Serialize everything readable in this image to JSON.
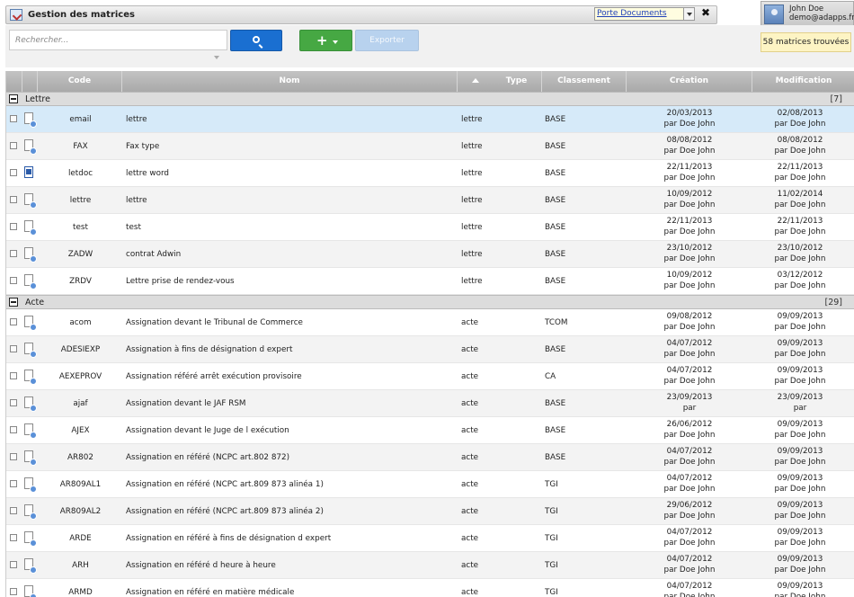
{
  "app": {
    "title": "Gestion des matrices"
  },
  "doc_selector": {
    "label": "Porte Documents"
  },
  "user": {
    "name": "John Doe",
    "email": "demo@adapps.fr"
  },
  "search": {
    "placeholder": "Rechercher..."
  },
  "toolbar": {
    "add_label": "+",
    "export_label": "Exporter"
  },
  "result_count": "58 matrices trouvées",
  "columns": {
    "code": "Code",
    "nom": "Nom",
    "type": "Type",
    "classement": "Classement",
    "creation": "Création",
    "modification": "Modification"
  },
  "groups": [
    {
      "label": "Lettre",
      "count": "[7]"
    },
    {
      "label": "Acte",
      "count": "[29]"
    }
  ],
  "rows_lettre": [
    {
      "code": "email",
      "nom": "lettre",
      "type": "lettre",
      "classement": "BASE",
      "cre_date": "20/03/2013",
      "cre_by": "par Doe John",
      "mod_date": "02/08/2013",
      "mod_by": "par Doe John"
    },
    {
      "code": "FAX",
      "nom": "Fax type",
      "type": "lettre",
      "classement": "BASE",
      "cre_date": "08/08/2012",
      "cre_by": "par Doe John",
      "mod_date": "08/08/2012",
      "mod_by": "par Doe John"
    },
    {
      "code": "letdoc",
      "nom": "lettre word",
      "type": "lettre",
      "classement": "BASE",
      "cre_date": "22/11/2013",
      "cre_by": "par Doe John",
      "mod_date": "22/11/2013",
      "mod_by": "par Doe John"
    },
    {
      "code": "lettre",
      "nom": "lettre",
      "type": "lettre",
      "classement": "BASE",
      "cre_date": "10/09/2012",
      "cre_by": "par Doe John",
      "mod_date": "11/02/2014",
      "mod_by": "par Doe John"
    },
    {
      "code": "test",
      "nom": "test",
      "type": "lettre",
      "classement": "BASE",
      "cre_date": "22/11/2013",
      "cre_by": "par Doe John",
      "mod_date": "22/11/2013",
      "mod_by": "par Doe John"
    },
    {
      "code": "ZADW",
      "nom": "contrat Adwin",
      "type": "lettre",
      "classement": "BASE",
      "cre_date": "23/10/2012",
      "cre_by": "par Doe John",
      "mod_date": "23/10/2012",
      "mod_by": "par Doe John"
    },
    {
      "code": "ZRDV",
      "nom": "Lettre prise de rendez-vous",
      "type": "lettre",
      "classement": "BASE",
      "cre_date": "10/09/2012",
      "cre_by": "par Doe John",
      "mod_date": "03/12/2012",
      "mod_by": "par Doe John"
    }
  ],
  "rows_acte": [
    {
      "code": "acom",
      "nom": "Assignation devant le Tribunal de Commerce",
      "type": "acte",
      "classement": "TCOM",
      "cre_date": "09/08/2012",
      "cre_by": "par Doe John",
      "mod_date": "09/09/2013",
      "mod_by": "par Doe John"
    },
    {
      "code": "ADESIEXP",
      "nom": "Assignation à fins de désignation d expert",
      "type": "acte",
      "classement": "BASE",
      "cre_date": "04/07/2012",
      "cre_by": "par Doe John",
      "mod_date": "09/09/2013",
      "mod_by": "par Doe John"
    },
    {
      "code": "AEXEPROV",
      "nom": "Assignation référé arrêt exécution provisoire",
      "type": "acte",
      "classement": "CA",
      "cre_date": "04/07/2012",
      "cre_by": "par Doe John",
      "mod_date": "09/09/2013",
      "mod_by": "par Doe John"
    },
    {
      "code": "ajaf",
      "nom": "Assignation devant le JAF RSM",
      "type": "acte",
      "classement": "BASE",
      "cre_date": "23/09/2013",
      "cre_by": "par",
      "mod_date": "23/09/2013",
      "mod_by": "par"
    },
    {
      "code": "AJEX",
      "nom": "Assignation devant le Juge de l exécution",
      "type": "acte",
      "classement": "BASE",
      "cre_date": "26/06/2012",
      "cre_by": "par Doe John",
      "mod_date": "09/09/2013",
      "mod_by": "par Doe John"
    },
    {
      "code": "AR802",
      "nom": "Assignation en référé (NCPC art.802 872)",
      "type": "acte",
      "classement": "BASE",
      "cre_date": "04/07/2012",
      "cre_by": "par Doe John",
      "mod_date": "09/09/2013",
      "mod_by": "par Doe John"
    },
    {
      "code": "AR809AL1",
      "nom": "Assignation en référé (NCPC art.809 873 alinéa 1)",
      "type": "acte",
      "classement": "TGI",
      "cre_date": "04/07/2012",
      "cre_by": "par Doe John",
      "mod_date": "09/09/2013",
      "mod_by": "par Doe John"
    },
    {
      "code": "AR809AL2",
      "nom": "Assignation en référé (NCPC art.809 873 alinéa 2)",
      "type": "acte",
      "classement": "TGI",
      "cre_date": "29/06/2012",
      "cre_by": "par Doe John",
      "mod_date": "09/09/2013",
      "mod_by": "par Doe John"
    },
    {
      "code": "ARDE",
      "nom": "Assignation en référé à fins de désignation d expert",
      "type": "acte",
      "classement": "TGI",
      "cre_date": "04/07/2012",
      "cre_by": "par Doe John",
      "mod_date": "09/09/2013",
      "mod_by": "par Doe John"
    },
    {
      "code": "ARH",
      "nom": "Assignation en référé d heure à heure",
      "type": "acte",
      "classement": "TGI",
      "cre_date": "04/07/2012",
      "cre_by": "par Doe John",
      "mod_date": "09/09/2013",
      "mod_by": "par Doe John"
    },
    {
      "code": "ARMD",
      "nom": "Assignation en référé en matière médicale",
      "type": "acte",
      "classement": "TGI",
      "cre_date": "04/07/2012",
      "cre_by": "par Doe John",
      "mod_date": "09/09/2013",
      "mod_by": "par Doe John"
    }
  ],
  "icons": {
    "app": "matrix-app-icon",
    "search": "search-icon",
    "close": "close-icon",
    "document": "document-icon",
    "word_document": "word-document-icon",
    "collapse": "collapse-icon",
    "sort": "sort-asc-icon"
  },
  "colors": {
    "search_button": "#1a6fd1",
    "add_button": "#46a843",
    "selected_row": "#d6eaf9",
    "header": "#b5b5b5"
  }
}
